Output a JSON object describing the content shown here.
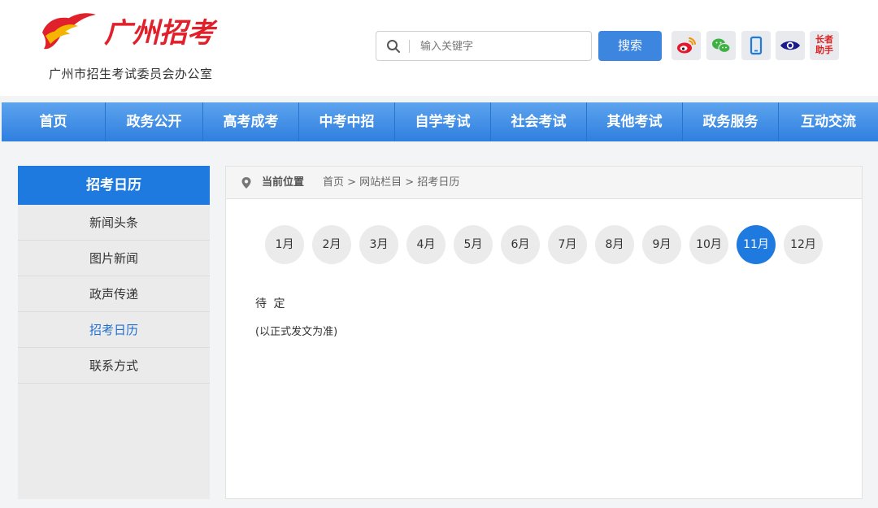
{
  "header": {
    "logo_text": "广州招考",
    "org_name": "广州市招生考试委员会办公室",
    "search_placeholder": "输入关键字",
    "search_button": "搜索",
    "social_icons": [
      "weibo-icon",
      "wechat-icon",
      "mobile-icon",
      "eye-icon",
      "assistant-icon"
    ],
    "assistant_text_top": "长者",
    "assistant_text_bottom": "助手"
  },
  "nav": {
    "items": [
      {
        "label": "首页"
      },
      {
        "label": "政务公开"
      },
      {
        "label": "高考成考"
      },
      {
        "label": "中考中招"
      },
      {
        "label": "自学考试"
      },
      {
        "label": "社会考试"
      },
      {
        "label": "其他考试"
      },
      {
        "label": "政务服务"
      },
      {
        "label": "互动交流"
      }
    ]
  },
  "sidebar": {
    "title": "招考日历",
    "items": [
      {
        "label": "新闻头条"
      },
      {
        "label": "图片新闻"
      },
      {
        "label": "政声传递"
      },
      {
        "label": "招考日历"
      },
      {
        "label": "联系方式"
      }
    ],
    "active_index": 3
  },
  "breadcrumb": {
    "label": "当前位置",
    "path": "首页 > 网站栏目 > 招考日历"
  },
  "months": {
    "items": [
      "1月",
      "2月",
      "3月",
      "4月",
      "5月",
      "6月",
      "7月",
      "8月",
      "9月",
      "10月",
      "11月",
      "12月"
    ],
    "selected": "11月"
  },
  "content": {
    "main_text": "待 定",
    "note": "(以正式发文为准)"
  },
  "colors": {
    "accent": "#1f7ae0",
    "nav_gradient_top": "#5da4ee",
    "nav_gradient_bottom": "#2f7fe0",
    "logo_red": "#e0202a",
    "logo_yellow": "#f5b400"
  }
}
